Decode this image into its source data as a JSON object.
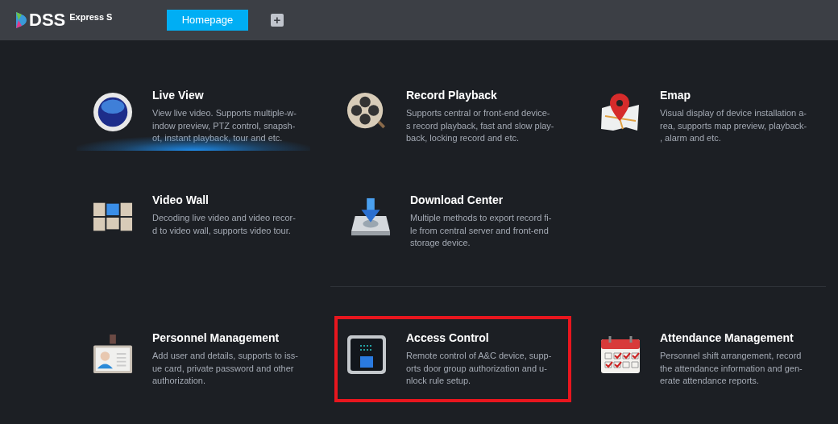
{
  "header": {
    "logo_text": "DSS",
    "logo_sub": "Express S",
    "tabs": [
      {
        "label": "Homepage",
        "selected": true
      }
    ],
    "add_tab": "+"
  },
  "modules": [
    {
      "kind": "live",
      "title": "Live View",
      "description": "View live video. Supports multiple-w-\nindow preview, PTZ control, snapsh-\not, instant playback, tour and etc.",
      "selected": true,
      "highlighted": false
    },
    {
      "kind": "playback",
      "title": "Record Playback",
      "description": "Supports central or front-end device-\ns record playback, fast and slow play-\nback, locking record and etc.",
      "selected": false,
      "highlighted": false
    },
    {
      "kind": "emap",
      "title": "Emap",
      "description": "Visual display of device installation a-\nrea, supports map preview, playback-\n, alarm and etc.",
      "selected": false,
      "highlighted": false
    },
    {
      "kind": "wall",
      "title": "Video Wall",
      "description": "Decoding live video and video recor-\nd to video wall, supports video tour.",
      "selected": false,
      "highlighted": false
    },
    {
      "kind": "download",
      "title": "Download Center",
      "description": "Multiple methods to export record fi-\nle from central server and front-end\nstorage device.",
      "selected": false,
      "highlighted": false
    },
    {
      "kind": "personnel",
      "title": "Personnel Management",
      "description": "Add user and details, supports to iss-\nue card, private password and other\nauthorization.",
      "selected": false,
      "highlighted": false
    },
    {
      "kind": "access",
      "title": "Access Control",
      "description": "Remote control of A&C device, supp-\norts door group authorization and u-\nnlock rule setup.",
      "selected": false,
      "highlighted": true
    },
    {
      "kind": "attendance",
      "title": "Attendance Management",
      "description": "Personnel shift arrangement, record\nthe attendance information and gen-\nerate attendance reports.",
      "selected": false,
      "highlighted": false
    }
  ]
}
